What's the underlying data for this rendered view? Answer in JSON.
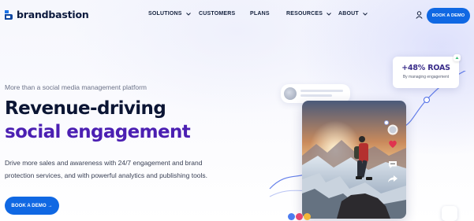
{
  "header": {
    "brand": "brandbastion",
    "nav": [
      {
        "label": "SOLUTIONS",
        "has_dropdown": true
      },
      {
        "label": "CUSTOMERS",
        "has_dropdown": false
      },
      {
        "label": "PLANS",
        "has_dropdown": false
      },
      {
        "label": "RESOURCES",
        "has_dropdown": true
      },
      {
        "label": "ABOUT",
        "has_dropdown": true
      }
    ],
    "account_icon": "user-icon",
    "cta_label": "BOOK A DEMO"
  },
  "hero": {
    "eyebrow": "More than a social media management platform",
    "headline_line1": "Revenue-driving",
    "headline_line2": "social engagement",
    "description_lines": [
      "Drive more sales and awareness with 24/7 engagement and brand",
      "protection services, and with powerful analytics and publishing tools."
    ],
    "cta_label": "BOOK A DEMO →"
  },
  "visual": {
    "roas_value": "+48% ROAS",
    "roas_caption": "By managing engagement",
    "post_icons": [
      "profile-icon",
      "heart-icon",
      "comment-icon",
      "share-icon"
    ],
    "reaction_icons": [
      "like-icon",
      "love-icon",
      "wow-icon"
    ]
  },
  "colors": {
    "primary_button": "#1068e3",
    "headline_dark": "#0b1534",
    "headline_accent": "#4b1fb2",
    "roas_text": "#3a2d8a"
  }
}
